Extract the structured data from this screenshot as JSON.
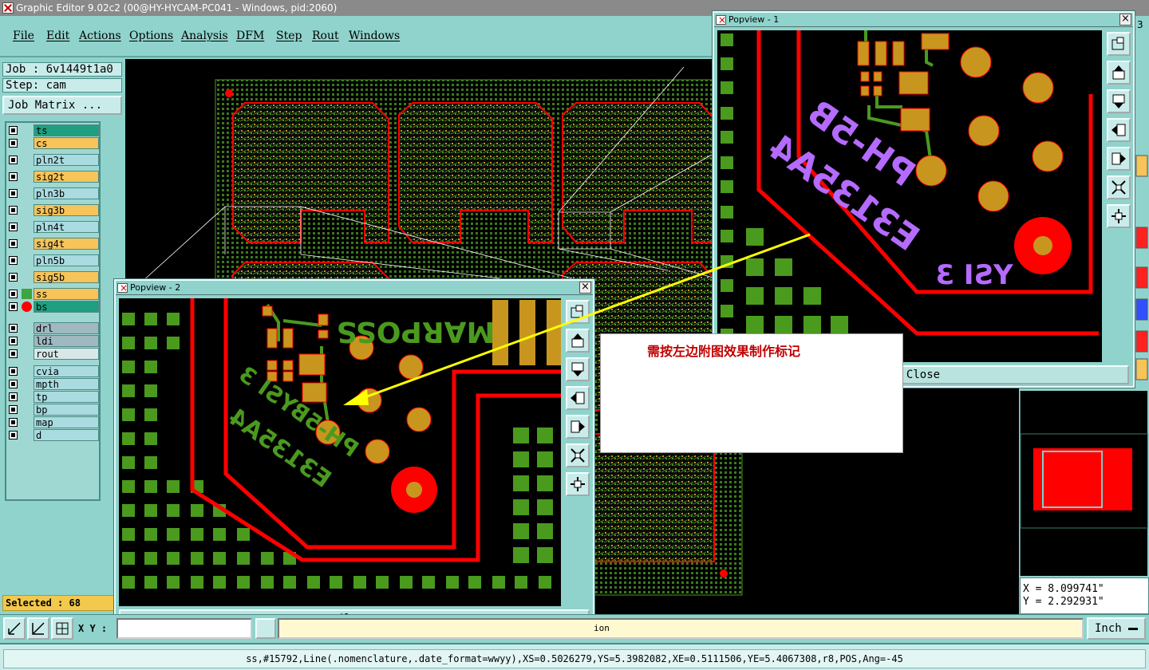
{
  "window": {
    "title": "Graphic Editor 9.02c2 (00@HY-HYCAM-PC041 - Windows, pid:2060)"
  },
  "menu": [
    "File",
    "Edit",
    "Actions",
    "Options",
    "Analysis",
    "DFM",
    "Step",
    "Rout",
    "Windows"
  ],
  "job": {
    "job_label": "Job : 6v1449t1a0",
    "step_label": "Step: cam",
    "matrix_button": "Job Matrix ..."
  },
  "layers": [
    {
      "name": "ts",
      "color": "#1f9f7f"
    },
    {
      "name": "cs",
      "color": "#f7c45a"
    },
    {
      "name": "pln2t",
      "color": "#a9dbe0"
    },
    {
      "name": "sig2t",
      "color": "#f7c45a"
    },
    {
      "name": "pln3b",
      "color": "#a9dbe0"
    },
    {
      "name": "sig3b",
      "color": "#f7c45a"
    },
    {
      "name": "pln4t",
      "color": "#a9dbe0"
    },
    {
      "name": "sig4t",
      "color": "#f7c45a"
    },
    {
      "name": "pln5b",
      "color": "#a9dbe0"
    },
    {
      "name": "sig5b",
      "color": "#f7c45a"
    },
    {
      "name": "ss",
      "color": "#f7c45a"
    },
    {
      "name": "bs",
      "color": "#1f9f7f"
    },
    {
      "name": "drl",
      "color": "#a0b8c0"
    },
    {
      "name": "ldi",
      "color": "#a0b8c0"
    },
    {
      "name": "rout",
      "color": "#d8e8e8"
    },
    {
      "name": "cvia",
      "color": "#a9dbe0"
    },
    {
      "name": "mpth",
      "color": "#a9dbe0"
    },
    {
      "name": "tp",
      "color": "#a9dbe0"
    },
    {
      "name": "bp",
      "color": "#a9dbe0"
    },
    {
      "name": "map",
      "color": "#a9dbe0"
    },
    {
      "name": "d",
      "color": "#a9dbe0"
    }
  ],
  "selection": {
    "label": "Selected : 68"
  },
  "popview1": {
    "title": "Popview - 1",
    "close_label": "Close",
    "close_icon": "×",
    "silk_text": [
      "PH-5B",
      "E3135A4"
    ],
    "silk_text2": "YSI 3"
  },
  "popview2": {
    "title": "Popview - 2",
    "close_label": "Close",
    "close_icon": "×",
    "top_text": "MARPOSS",
    "silk_text": [
      "PH-5BYSI 3",
      "E3135A4"
    ]
  },
  "note": {
    "text": "需按左边附图效果制作标记"
  },
  "coords": {
    "x": "X = 8.099741\"",
    "y": "Y = 2.292931\""
  },
  "bottom": {
    "xy_label": "X Y :",
    "message": "ion",
    "unit": "Inch"
  },
  "status": {
    "text": "ss,#15792,Line(.nomenclature,.date_format=wwyy),XS=0.5026279,YS=5.3982082,XE=0.5111506,YE=5.4067308,r8,POS,Ang=-45"
  },
  "colors": {
    "copper": "#c8961e",
    "silk_green": "#4a9a1e",
    "outline_red": "#ff0000",
    "silk_purple": "#b56bff",
    "arrow_yellow": "#ffff00",
    "note_red": "#c00000"
  },
  "icons": [
    "zoom-icon",
    "pan-icon",
    "fit-icon",
    "measure-icon",
    "grid-icon",
    "snap-icon"
  ]
}
